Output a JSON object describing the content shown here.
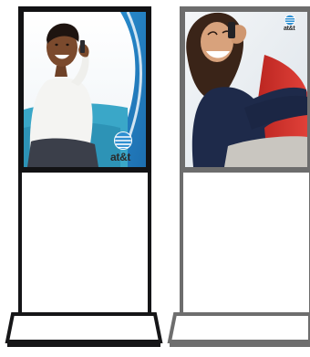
{
  "sign_left": {
    "brand": "at&t",
    "frame_color": "#101012",
    "ad_background": "#3fa3d9"
  },
  "sign_right": {
    "brand": "at&t",
    "frame_color": "#6c6c6c",
    "ad_background": "#d83a2f"
  }
}
